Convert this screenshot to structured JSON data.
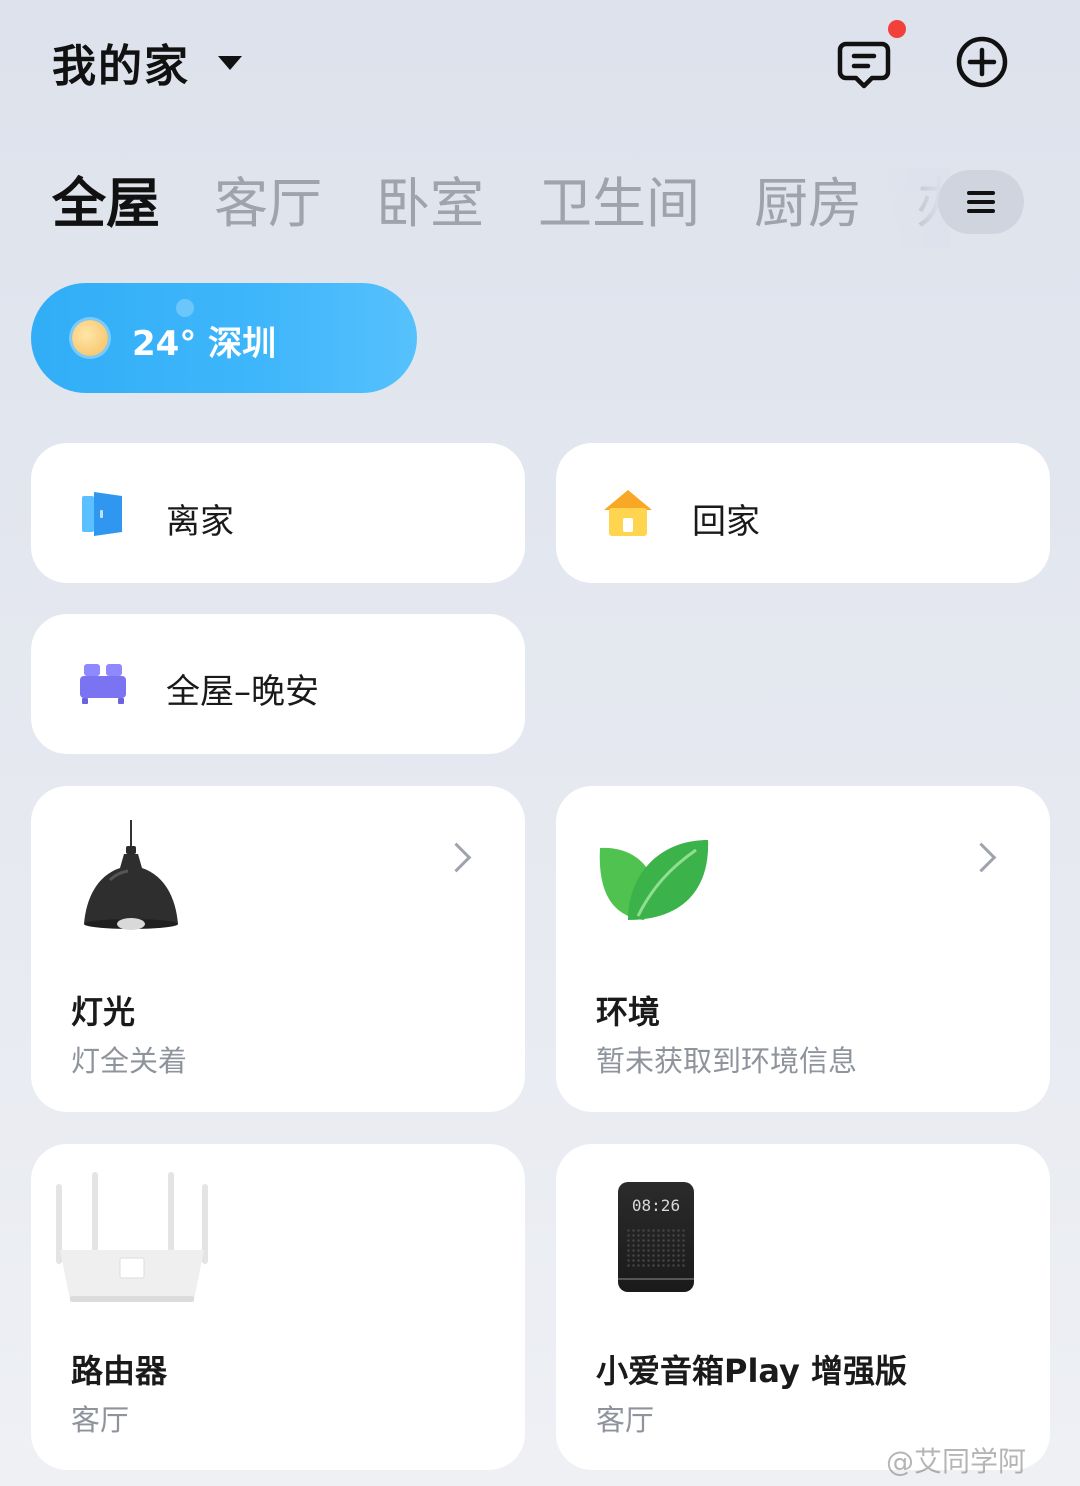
{
  "header": {
    "home_title": "我的家"
  },
  "tabs": [
    "全屋",
    "客厅",
    "卧室",
    "卫生间",
    "厨房",
    "办"
  ],
  "weather": {
    "text": "24° 深圳"
  },
  "scenes": [
    {
      "label": "离家",
      "icon": "door-exit-icon"
    },
    {
      "label": "回家",
      "icon": "house-icon"
    },
    {
      "label": "全屋–晚安",
      "icon": "bed-icon"
    }
  ],
  "devices": [
    {
      "name": "灯光",
      "sub": "灯全关着",
      "icon": "pendant-lamp-icon"
    },
    {
      "name": "环境",
      "sub": "暂未获取到环境信息",
      "icon": "leaf-icon"
    },
    {
      "name": "路由器",
      "sub": "客厅",
      "icon": "router-icon"
    },
    {
      "name": "小爱音箱Play 增强版",
      "sub": "客厅",
      "icon": "smart-speaker-icon",
      "clock": "08:26"
    }
  ],
  "watermark": "@艾同学阿",
  "colors": {
    "accent": "#3fb6fb",
    "notify_dot": "#f2403a",
    "scene_bed": "#7b74f2",
    "scene_home": "#f8c23a",
    "scene_exit": "#3aa3f5"
  }
}
